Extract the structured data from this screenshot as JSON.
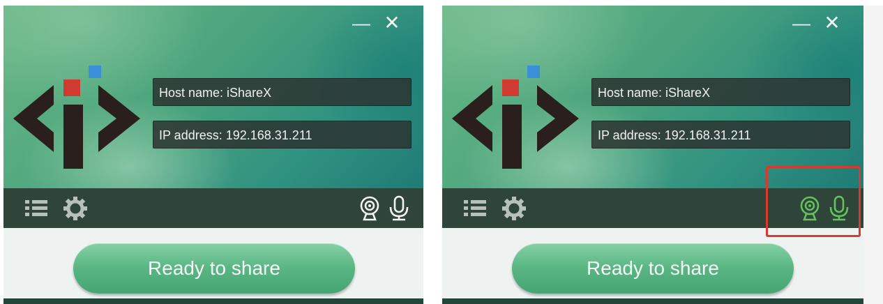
{
  "window": {
    "minimize_glyph": "—",
    "close_glyph": "✕"
  },
  "info": {
    "host_label": "Host name: iShareX",
    "ip_label": "IP address: 192.168.31.211"
  },
  "toolbar": {
    "icons": [
      "list-menu-icon",
      "settings-gear-icon",
      "webcam-icon",
      "microphone-icon"
    ]
  },
  "share_button": {
    "label": "Ready to share"
  },
  "states": [
    {
      "id": "left",
      "device_icon_color": "#f2f2f2",
      "highlighted": false
    },
    {
      "id": "right",
      "device_icon_color": "#63c25e",
      "highlighted": true
    }
  ],
  "colors": {
    "toolbar_bg": "#30453a",
    "highlight": "#d93a2c",
    "logo_dark": "#2a1f1c",
    "logo_red": "#d13a30",
    "logo_blue": "#3b8fd9"
  }
}
